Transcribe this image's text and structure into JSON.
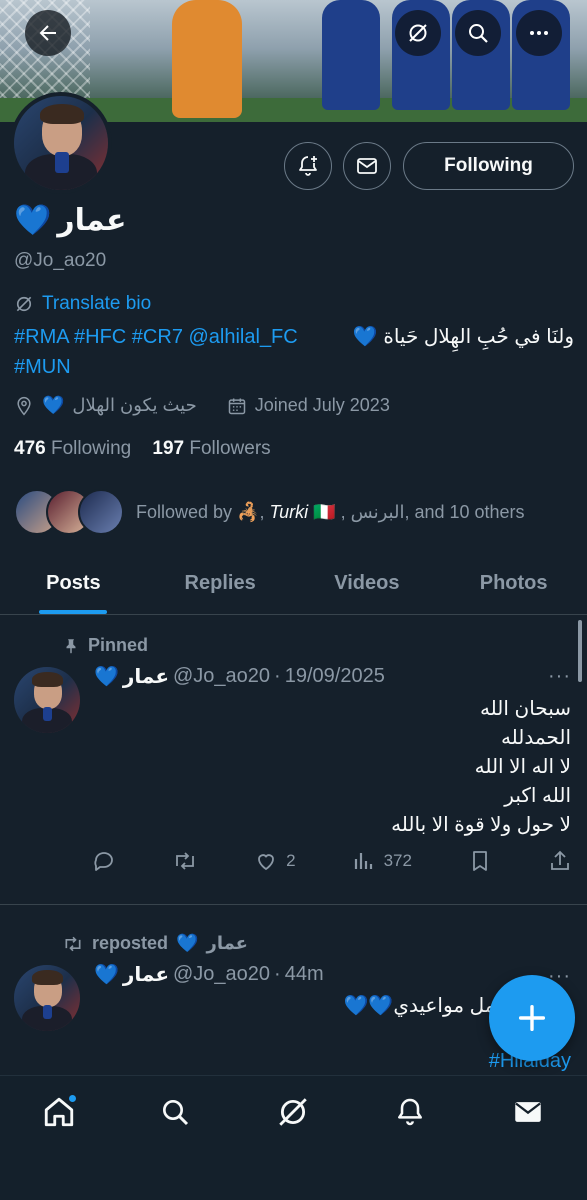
{
  "profile": {
    "name": "عمار",
    "name_emoji": "💙",
    "handle": "@Jo_ao20",
    "translate_label": "Translate bio",
    "bio_tags": "#RMA #HFC #CR7 @alhilal_FC",
    "bio_emoji": "💙",
    "bio_arabic": "ولنَا في حُبِ الهِلال حَياة",
    "bio_line2": "#MUN",
    "location_emoji": "💙",
    "location": "حيث يكون الهلال",
    "joined": "Joined July 2023",
    "following_count": "476",
    "following_label": "Following",
    "followers_count": "197",
    "followers_label": "Followers",
    "follow_button": "Following",
    "followed_by_prefix": "Followed by",
    "followed_by_emoji": "🦂",
    "followed_by_name": "Turki",
    "followed_by_flag": "🇮🇹",
    "followed_by_rest": ", البرنس, and 10 others"
  },
  "tabs": [
    "Posts",
    "Replies",
    "Videos",
    "Photos"
  ],
  "pinned_tweet": {
    "context": "Pinned",
    "name": "عمار",
    "name_emoji": "💙",
    "handle": "@Jo_ao20",
    "sep": "·",
    "time": "19/09/2025",
    "lines": [
      "سبحان الله",
      "الحمدلله",
      "لا اله الا الله",
      "الله اكبر",
      "لا حول ولا قوة الا بالله"
    ],
    "replies": "",
    "retweets": "",
    "likes": "2",
    "views": "372",
    "more": "···"
  },
  "repost_tweet": {
    "context": "reposted",
    "context_name": "عمار",
    "context_emoji": "💙",
    "name": "عمار",
    "name_emoji": "💙",
    "handle": "@Jo_ao20",
    "sep": "·",
    "time": "44m",
    "text": "ـاك يا أجمل مواعيدي",
    "text_emoji": "💙💙",
    "text_lead": "ا",
    "hashtag": "#Hilalday",
    "more": "···"
  },
  "colors": {
    "accent": "#1d9bf0",
    "background": "#15202b",
    "muted": "#8b98a5",
    "border": "#38444d"
  },
  "icons": [
    "back-arrow-icon",
    "grok-icon",
    "search-icon",
    "more-icon",
    "bell-plus-icon",
    "mail-icon",
    "home-icon",
    "notifications-icon",
    "plus-icon"
  ]
}
